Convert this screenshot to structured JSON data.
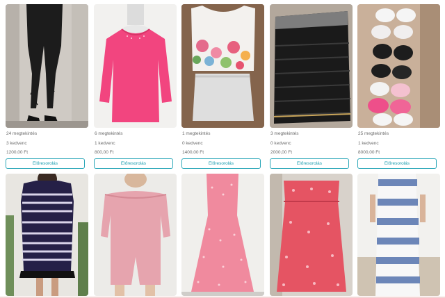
{
  "listings": [
    {
      "views": "24 megtekintés",
      "favorites": "3 kedvenc",
      "price": "1200,00 Ft",
      "button": "Előresorolás",
      "image": "black-lace-up-leggings-photo"
    },
    {
      "views": "6 megtekintés",
      "favorites": "1 kedvenc",
      "price": "800,00 Ft",
      "button": "Előresorolás",
      "image": "pink-top-photo"
    },
    {
      "views": "1 megtekintés",
      "favorites": "0 kedvenc",
      "price": "1400,00 Ft",
      "button": "Előresorolás",
      "image": "floral-top-photo"
    },
    {
      "views": "3 megtekintés",
      "favorites": "0 kedvenc",
      "price": "2000,00 Ft",
      "button": "Előresorolás",
      "image": "black-skirt-photo"
    },
    {
      "views": "25 megtekintés",
      "favorites": "1 kedvenc",
      "price": "8000,00 Ft",
      "button": "Előresorolás",
      "image": "bras-photo"
    }
  ],
  "row2": [
    {
      "image": "striped-dress-photo"
    },
    {
      "image": "pink-jumpsuit-photo"
    },
    {
      "image": "pink-floral-dress-photo"
    },
    {
      "image": "red-floral-dress-photo"
    },
    {
      "image": "blue-white-maxi-dress-photo"
    }
  ]
}
